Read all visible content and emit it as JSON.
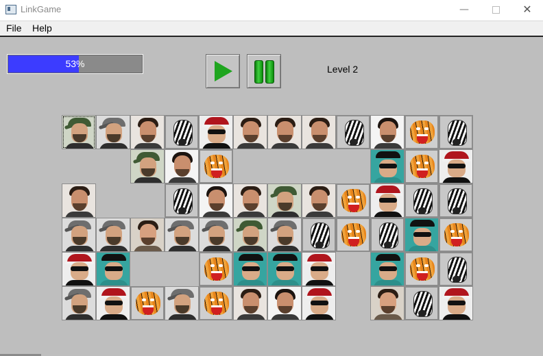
{
  "window": {
    "title": "LinkGame",
    "minimize_glyph": "—",
    "close_glyph": "✕"
  },
  "menu": {
    "file": "File",
    "help": "Help"
  },
  "progress": {
    "value": 0.53,
    "label": "53%",
    "fill_color": "#3c3cff"
  },
  "controls": {
    "play_icon": "play-icon",
    "pause_icon": "pause-icon"
  },
  "level": {
    "label": "Level 2"
  },
  "board": {
    "rows": 6,
    "cols": 12,
    "selected": [
      0,
      0
    ],
    "tiles": [
      [
        "cap-green",
        "cap",
        "face",
        "zebra",
        "sun",
        "face",
        "face",
        "face",
        "zebra",
        "face3",
        "tiger",
        "zebra"
      ],
      [
        "",
        "",
        "cap-green",
        "face3",
        "tiger",
        "",
        "",
        "",
        "",
        "sun-teal",
        "tiger",
        "sun"
      ],
      [
        "face",
        "",
        "",
        "zebra",
        "face3",
        "face",
        "cap-green",
        "face",
        "tiger",
        "sun",
        "zebra",
        "zebra"
      ],
      [
        "cap",
        "cap",
        "face2",
        "cap",
        "cap",
        "cap-green",
        "cap",
        "zebra",
        "tiger",
        "zebra",
        "sun-teal",
        "tiger"
      ],
      [
        "sun",
        "sun-teal",
        "",
        "",
        "tiger",
        "sun-teal",
        "sun-teal",
        "sun",
        "",
        "sun-teal",
        "tiger",
        "zebra"
      ],
      [
        "cap",
        "sun",
        "tiger",
        "cap",
        "tiger",
        "face",
        "face3",
        "sun",
        "",
        "face2",
        "zebra",
        "sun"
      ]
    ]
  }
}
